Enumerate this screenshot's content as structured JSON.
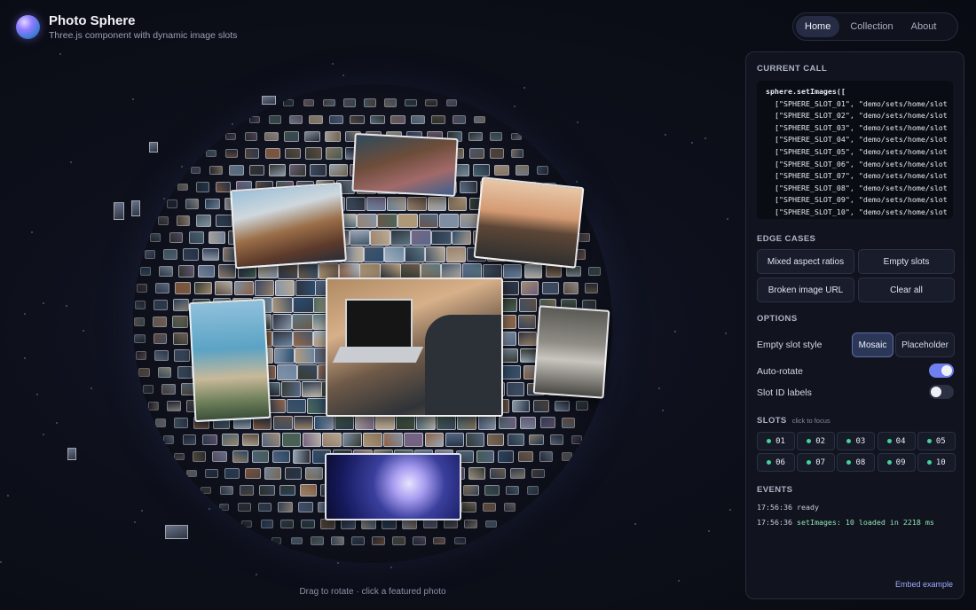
{
  "app": {
    "title": "Photo Sphere",
    "subtitle": "Three.js component with dynamic image slots"
  },
  "nav": {
    "items": [
      {
        "label": "Home",
        "active": true
      },
      {
        "label": "Collection",
        "active": false
      },
      {
        "label": "About",
        "active": false
      }
    ]
  },
  "canvas": {
    "hint": "Drag to rotate · click a featured photo"
  },
  "panel": {
    "current_call": {
      "heading": "CURRENT CALL",
      "lines": [
        "sphere.setImages([",
        "  [\"SPHERE_SLOT_01\", \"demo/sets/home/slot",
        "  [\"SPHERE_SLOT_02\", \"demo/sets/home/slot",
        "  [\"SPHERE_SLOT_03\", \"demo/sets/home/slot",
        "  [\"SPHERE_SLOT_04\", \"demo/sets/home/slot",
        "  [\"SPHERE_SLOT_05\", \"demo/sets/home/slot",
        "  [\"SPHERE_SLOT_06\", \"demo/sets/home/slot",
        "  [\"SPHERE_SLOT_07\", \"demo/sets/home/slot",
        "  [\"SPHERE_SLOT_08\", \"demo/sets/home/slot",
        "  [\"SPHERE_SLOT_09\", \"demo/sets/home/slot",
        "  [\"SPHERE_SLOT_10\", \"demo/sets/home/slot"
      ]
    },
    "edge_cases": {
      "heading": "EDGE CASES",
      "mixed": "Mixed aspect ratios",
      "empty": "Empty slots",
      "broken": "Broken image URL",
      "clear": "Clear all"
    },
    "options": {
      "heading": "OPTIONS",
      "empty_slot_style": "Empty slot style",
      "mosaic": "Mosaic",
      "placeholder": "Placeholder",
      "selected_style": "Mosaic",
      "auto_rotate": "Auto-rotate",
      "auto_rotate_on": true,
      "slot_id_labels": "Slot ID labels",
      "slot_id_labels_on": false
    },
    "slots": {
      "heading": "SLOTS",
      "hint": "click to focus",
      "items": [
        "01",
        "02",
        "03",
        "04",
        "05",
        "06",
        "07",
        "08",
        "09",
        "10"
      ]
    },
    "events": {
      "heading": "EVENTS",
      "items": [
        {
          "time": "17:56:36",
          "msg": "ready"
        },
        {
          "time": "17:56:36",
          "msg": "setImages: 10 loaded in 2218 ms"
        }
      ]
    },
    "embed_link": "Embed example"
  },
  "colors": {
    "accent": "#6f7ff0",
    "slot_dot": "#43d39b",
    "event_ok": "#8fe2b6"
  }
}
